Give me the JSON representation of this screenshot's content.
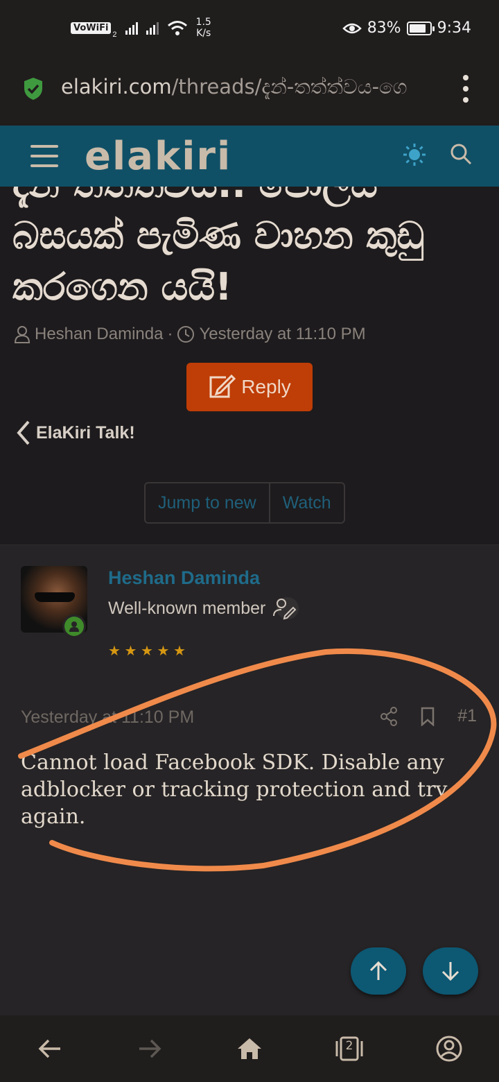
{
  "status_bar": {
    "vowifi": "VoWiFi",
    "sim_slot": "2",
    "speed_value": "1.5",
    "speed_unit": "K/s",
    "battery_pct": "83%",
    "battery_level": 0.83,
    "time": "9:34"
  },
  "browser": {
    "url_host": "elakiri.com",
    "url_path": "/threads/දැන්-තත්ත්වය-ගෙ"
  },
  "header": {
    "logo": "elakiri"
  },
  "thread": {
    "title": "දැන් තත්ත්වය.. පොලිස් බසයක් පැමිණ වාහන කුඩු කරගෙන යයි!",
    "author": "Heshan Daminda",
    "separator": "·",
    "date": "Yesterday at 11:10 PM"
  },
  "actions": {
    "reply_label": "Reply",
    "breadcrumb": "ElaKiri Talk!",
    "jump_label": "Jump to new",
    "watch_label": "Watch"
  },
  "post": {
    "username": "Heshan Daminda",
    "user_title": "Well-known member",
    "stars": "★ ★ ★ ★ ★",
    "rating": 5,
    "date": "Yesterday at 11:10 PM",
    "number": "#1",
    "body": "Cannot load Facebook SDK. Disable any adblocker or tracking protection and try again."
  },
  "navbar": {
    "tab_count": "2"
  },
  "colors": {
    "accent": "#105066",
    "reply": "#bf3d06",
    "annotation": "#f08a4b"
  }
}
